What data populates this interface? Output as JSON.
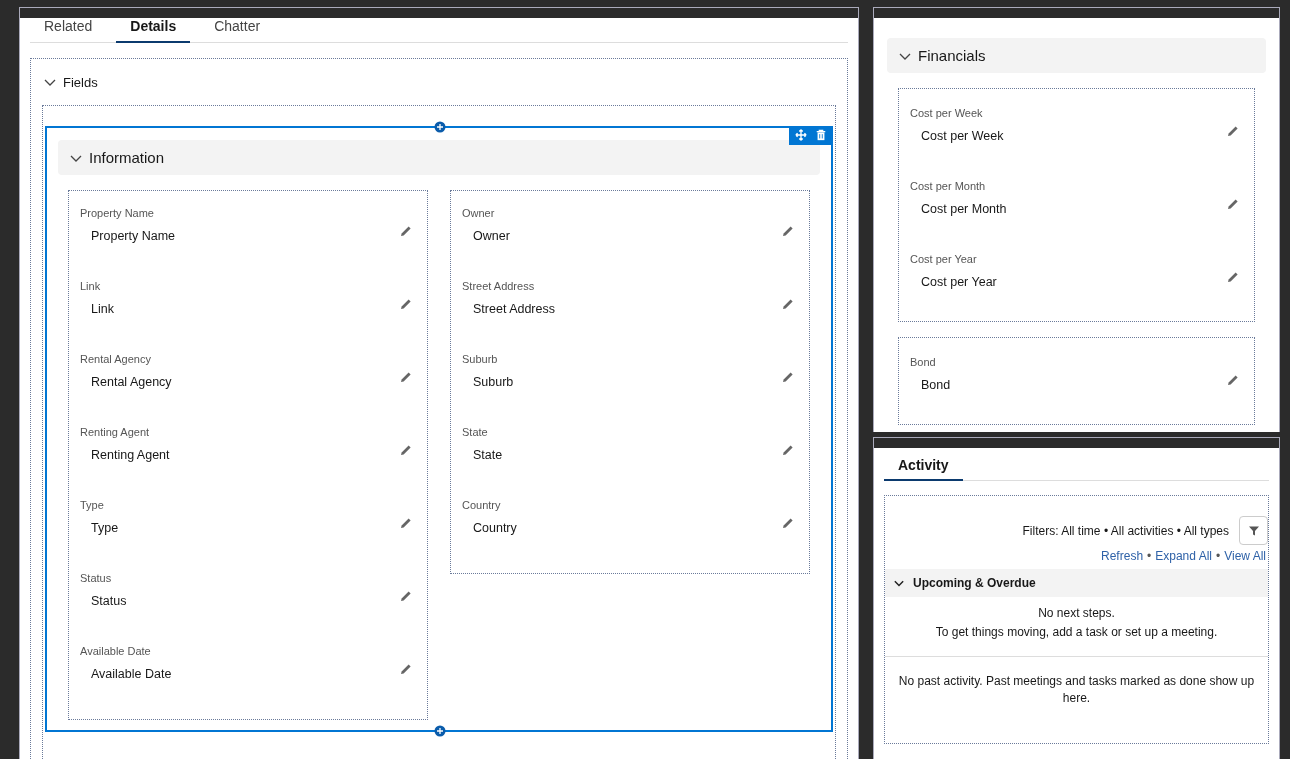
{
  "tabs": [
    {
      "label": "Related",
      "selected": false
    },
    {
      "label": "Details",
      "selected": true
    },
    {
      "label": "Chatter",
      "selected": false
    }
  ],
  "fields_section": {
    "title": "Fields",
    "expanded": true
  },
  "information": {
    "title": "Information",
    "expanded": true,
    "columns": [
      [
        {
          "label": "Property Name",
          "value": "Property Name"
        },
        {
          "label": "Link",
          "value": "Link"
        },
        {
          "label": "Rental Agency",
          "value": "Rental Agency"
        },
        {
          "label": "Renting Agent",
          "value": "Renting Agent"
        },
        {
          "label": "Type",
          "value": "Type"
        },
        {
          "label": "Status",
          "value": "Status"
        },
        {
          "label": "Available Date",
          "value": "Available Date"
        }
      ],
      [
        {
          "label": "Owner",
          "value": "Owner"
        },
        {
          "label": "Street Address",
          "value": "Street Address"
        },
        {
          "label": "Suburb",
          "value": "Suburb"
        },
        {
          "label": "State",
          "value": "State"
        },
        {
          "label": "Country",
          "value": "Country"
        }
      ]
    ]
  },
  "financials": {
    "title": "Financials",
    "expanded": true,
    "groups": [
      [
        {
          "label": "Cost per Week",
          "value": "Cost per Week"
        },
        {
          "label": "Cost per Month",
          "value": "Cost per Month"
        },
        {
          "label": "Cost per Year",
          "value": "Cost per Year"
        }
      ],
      [
        {
          "label": "Bond",
          "value": "Bond"
        }
      ]
    ]
  },
  "activity": {
    "tabs": [
      {
        "label": "Activity",
        "selected": true
      }
    ],
    "filters": "Filters: All time • All activities • All types",
    "links": [
      "Refresh",
      "Expand All",
      "View All"
    ],
    "link_separator": "•",
    "upcoming": {
      "title": "Upcoming & Overdue",
      "expanded": true,
      "lines": [
        "No next steps.",
        "To get things moving, add a task or set up a meeting."
      ]
    },
    "past": "No past activity. Past meetings and tasks marked as done show up here."
  }
}
